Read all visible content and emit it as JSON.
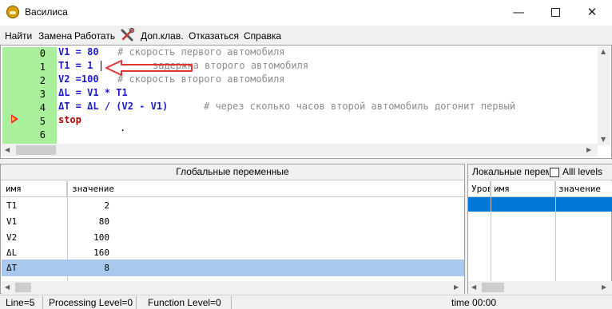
{
  "window": {
    "title": "Василиса"
  },
  "menu": [
    "Найти",
    "Замена",
    "Работать",
    "Доп.клав.",
    "Отказаться",
    "Справка"
  ],
  "editor": {
    "line_numbers": [
      "0",
      "1",
      "2",
      "3",
      "4",
      "5",
      "6"
    ],
    "lines": [
      {
        "code": "V1 = 80",
        "comment": "# скорость первого автомобиля"
      },
      {
        "code": "T1 = 1",
        "comment": "задержка второго автомобиля"
      },
      {
        "code": "V2 =100",
        "comment": "# скорость второго автомобиля"
      },
      {
        "code": "ΔL = V1 * T1",
        "comment": ""
      },
      {
        "code": "ΔT = ΔL / (V2 - V1)",
        "comment": "# через сколько часов второй автомобиль догонит первый"
      },
      {
        "code": "stop",
        "comment": ""
      },
      {
        "code": ".",
        "comment": ""
      }
    ],
    "current_line": 5
  },
  "globals": {
    "title": "Глобальные переменные",
    "columns": [
      "имя",
      "значение"
    ],
    "rows": [
      {
        "name": "T1",
        "value": "2"
      },
      {
        "name": "V1",
        "value": "80"
      },
      {
        "name": "V2",
        "value": "100"
      },
      {
        "name": "ΔL",
        "value": "160"
      },
      {
        "name": "ΔT",
        "value": "8"
      }
    ],
    "selected_row": 4
  },
  "locals": {
    "title": "Локальные переменные",
    "all_levels_label": "Alll levels",
    "all_levels_checked": false,
    "columns": [
      "Уровень",
      "имя",
      "значение"
    ]
  },
  "status": {
    "line": "Line=5",
    "processing": "Processing Level=0",
    "function": "Function Level=0",
    "time": "time 00:00"
  },
  "icons": [
    "app-icon",
    "tools-icon",
    "minimize-icon",
    "maximize-icon",
    "close-icon",
    "breakpoint-arrow-icon",
    "annotation-arrow"
  ],
  "colors": {
    "gutter": "#a9ef9c",
    "selection": "#a8c8ee",
    "locals_selection": "#0078d7",
    "annotation": "#e33333"
  }
}
